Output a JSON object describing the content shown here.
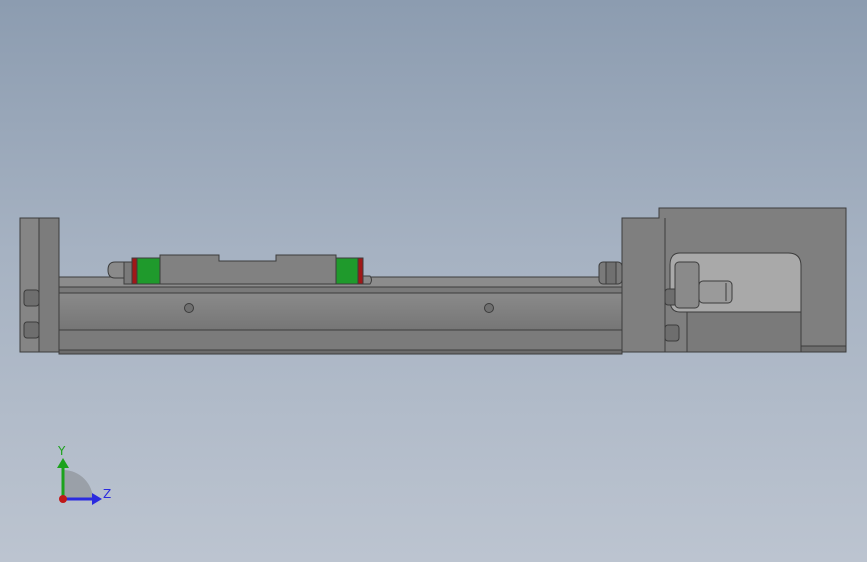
{
  "viewport": {
    "background_top": "#8c9cb0",
    "background_bottom": "#bcc4d0",
    "part_fill": "#7f7f7f",
    "part_edge": "#3c3c3c",
    "accent_green": "#1f9a2c",
    "accent_red": "#a01818"
  },
  "triad": {
    "y_label": "Y",
    "z_label": "Z",
    "y_color": "#1ca21c",
    "z_color": "#2a2adf",
    "x_color": "#c01818",
    "icon": "coordinate-triad-icon"
  }
}
